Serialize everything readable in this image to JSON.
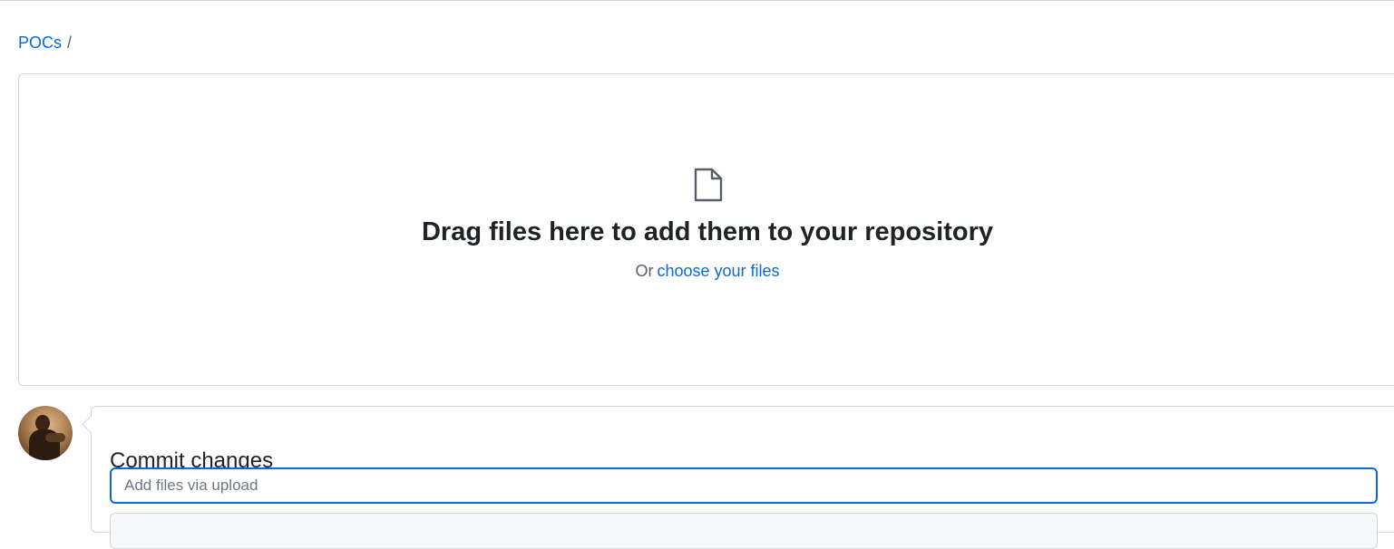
{
  "breadcrumb": {
    "repo": "POCs",
    "separator": "/"
  },
  "dropzone": {
    "icon": "file-icon",
    "title": "Drag files here to add them to your repository",
    "prefix": "Or",
    "choose_link": "choose your files"
  },
  "commit": {
    "avatar_icon": "avatar",
    "title": "Commit changes",
    "summary_placeholder": "Add files via upload",
    "summary_value": ""
  },
  "colors": {
    "link": "#0969da",
    "border": "#d0d7de",
    "focus": "#0969da",
    "text": "#1f2328",
    "muted": "#57606a"
  }
}
